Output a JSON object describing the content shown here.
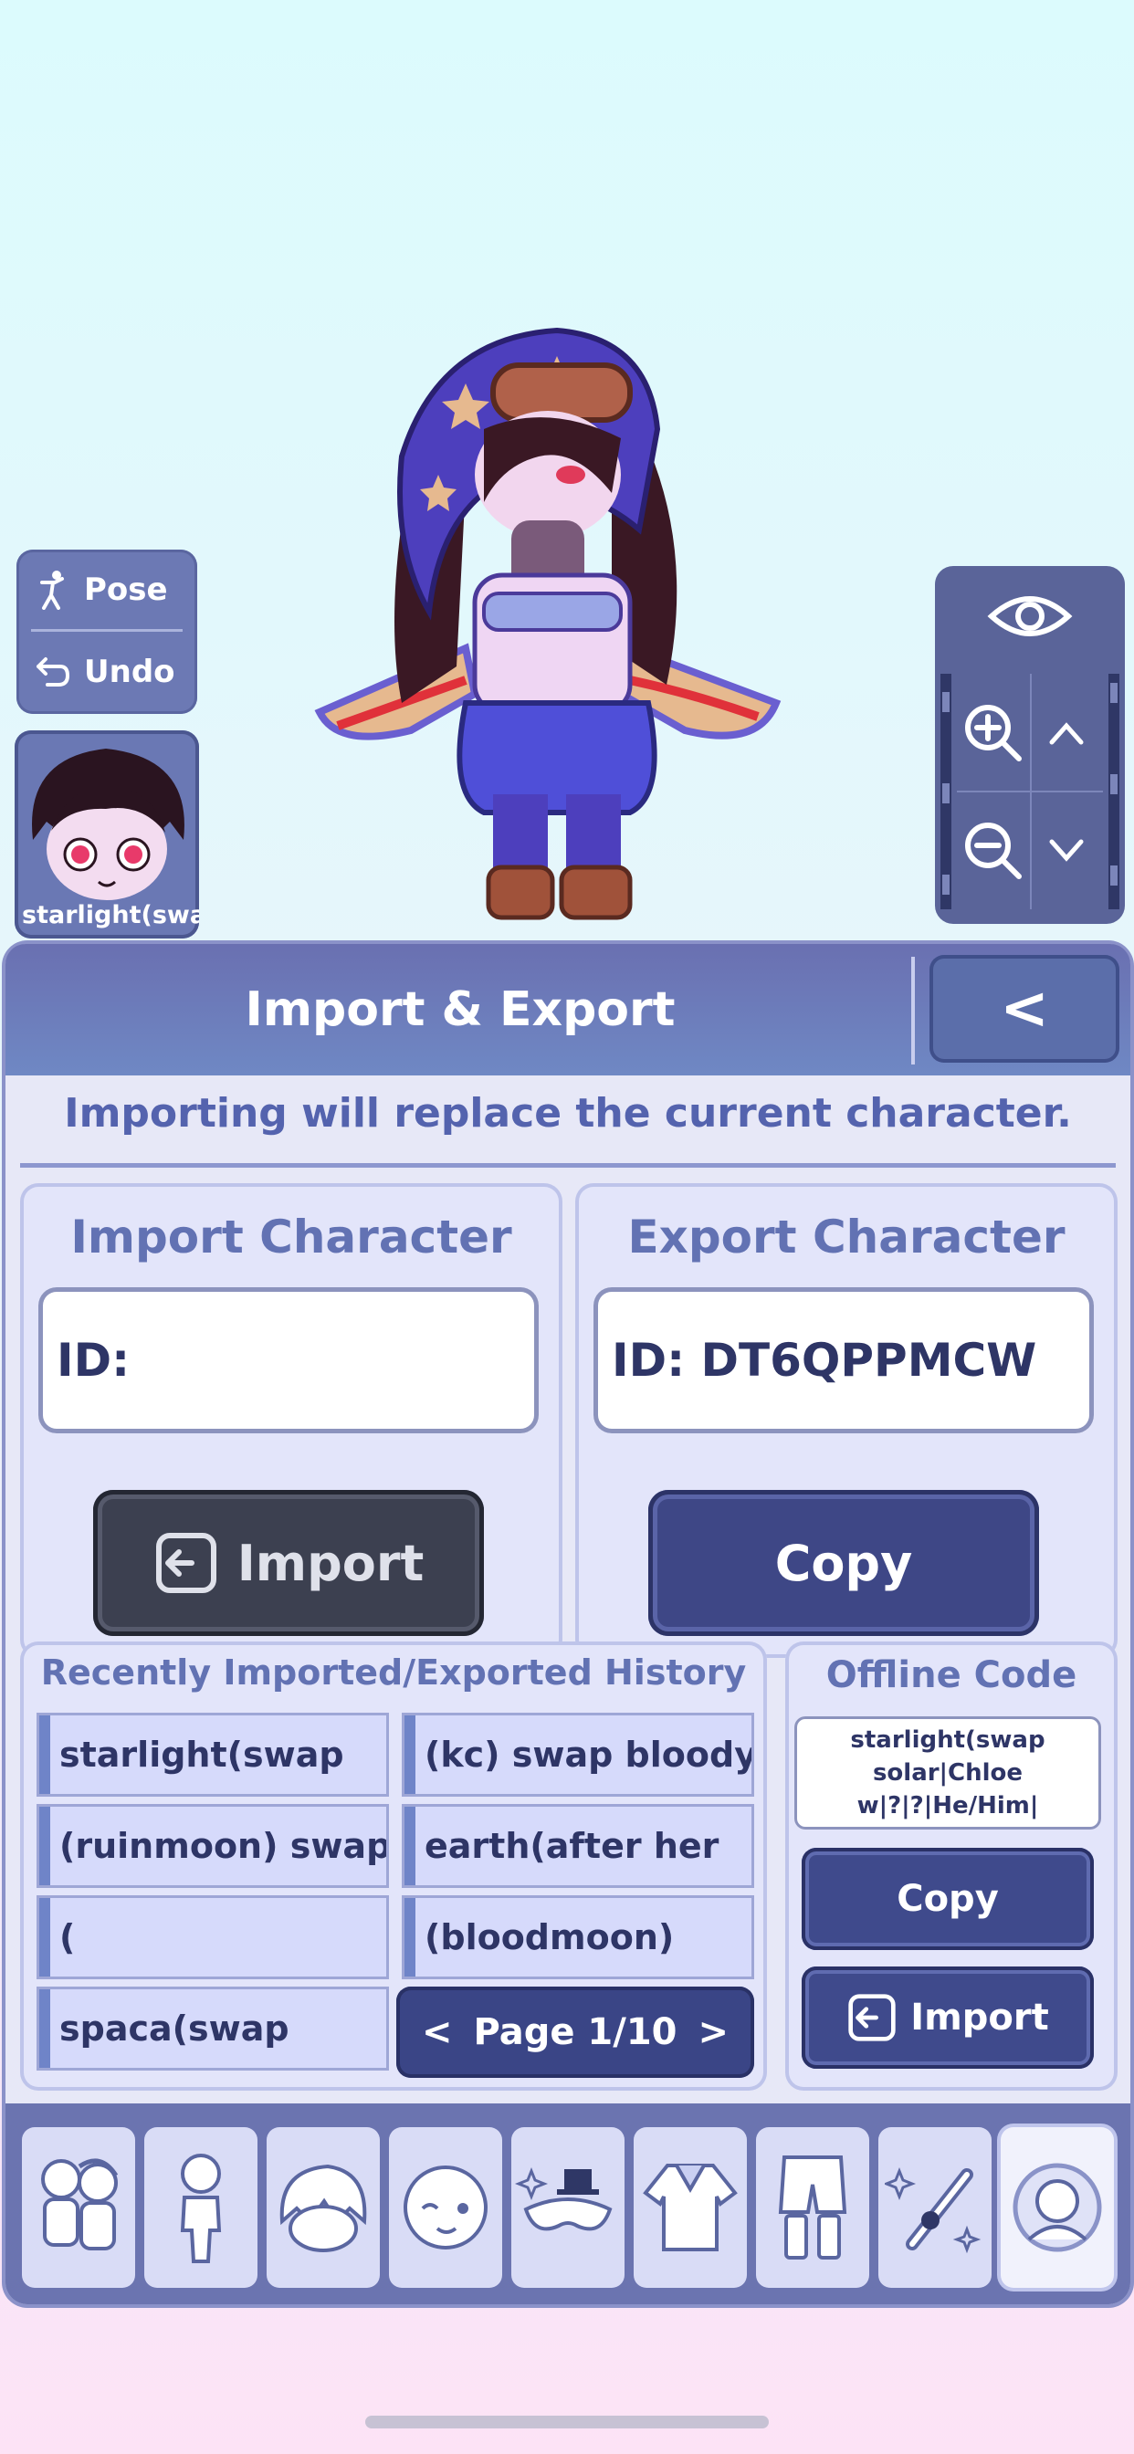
{
  "left_controls": {
    "pose_label": "Pose",
    "undo_label": "Undo",
    "character_label": "starlight(swap"
  },
  "camera_controls": {
    "zoom_in_icon": "zoom-in-icon",
    "zoom_out_icon": "zoom-out-icon"
  },
  "panel": {
    "title": "Import & Export",
    "back_label": "<",
    "warning": "Importing will replace the current character."
  },
  "import": {
    "title": "Import Character",
    "id_value": "ID:",
    "button_label": "Import"
  },
  "export": {
    "title": "Export Character",
    "id_value": "ID: DT6QPPMCW",
    "button_label": "Copy"
  },
  "history": {
    "title": "Recently Imported/Exported History",
    "items": [
      "starlight(swap",
      "(kc) swap bloody",
      "(ruinmoon) swap",
      "earth(after her",
      "(",
      "(bloodmoon)",
      "spaca(swap"
    ],
    "pager": {
      "prev": "<",
      "label": "Page 1/10",
      "next": ">"
    }
  },
  "offline": {
    "title": "Offline Code",
    "code_lines": [
      "starlight(swap",
      "solar|Chloe",
      "w|?|?|He/Him|"
    ],
    "copy_label": "Copy",
    "import_label": "Import"
  },
  "tabs": [
    {
      "name": "presets-icon"
    },
    {
      "name": "body-icon"
    },
    {
      "name": "hair-icon"
    },
    {
      "name": "face-icon"
    },
    {
      "name": "accessories-icon"
    },
    {
      "name": "top-clothing-icon"
    },
    {
      "name": "bottom-clothing-icon"
    },
    {
      "name": "props-icon"
    },
    {
      "name": "profile-icon"
    }
  ],
  "colors": {
    "panel_header": "#6a70b1",
    "accent_blue": "#3e4786",
    "import_dark": "#3c4050",
    "text_blue": "#5463ae"
  }
}
